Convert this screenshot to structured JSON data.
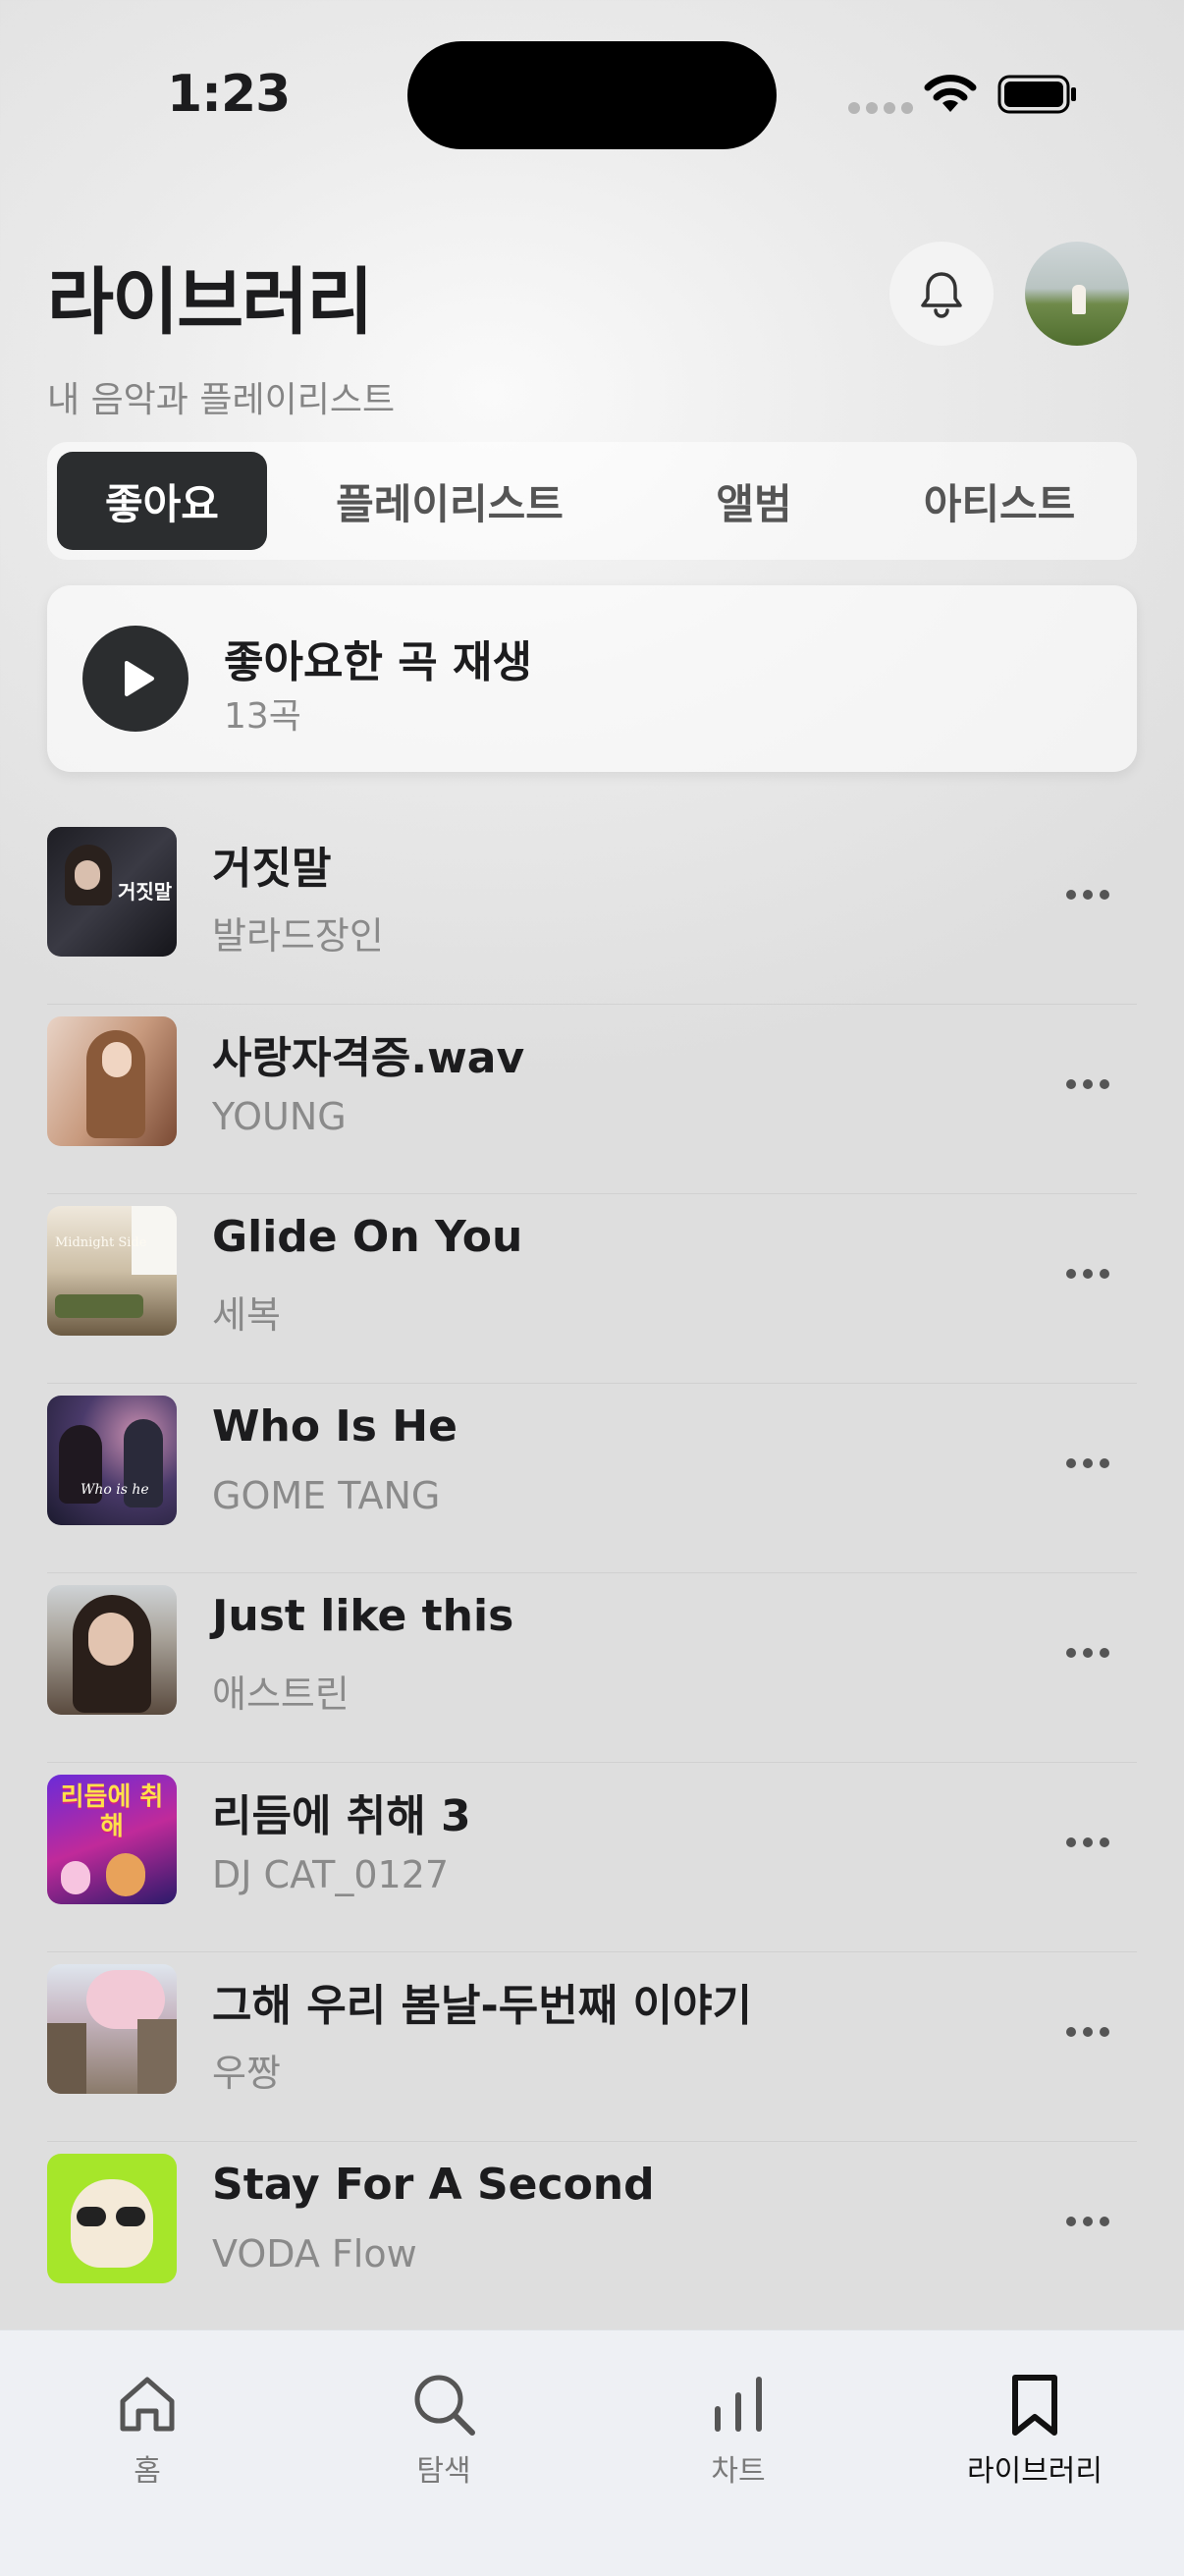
{
  "status_bar": {
    "time": "1:23"
  },
  "header": {
    "title": "라이브러리",
    "subtitle": "내 음악과 플레이리스트"
  },
  "tabs": [
    {
      "label": "좋아요",
      "active": true
    },
    {
      "label": "플레이리스트",
      "active": false
    },
    {
      "label": "앨범",
      "active": false
    },
    {
      "label": "아티스트",
      "active": false
    }
  ],
  "play_card": {
    "title": "좋아요한 곡 재생",
    "count": "13곡"
  },
  "songs": [
    {
      "title": "거짓말",
      "artist": "발라드장인"
    },
    {
      "title": "사랑자격증.wav",
      "artist": "YOUNG"
    },
    {
      "title": "Glide On You",
      "artist": "세복"
    },
    {
      "title": "Who Is He",
      "artist": "GOME TANG"
    },
    {
      "title": "Just like this",
      "artist": "애스트린"
    },
    {
      "title": "리듬에 취해 3",
      "artist": "DJ CAT_0127"
    },
    {
      "title": "그해 우리 봄날-두번째 이야기",
      "artist": "우짱"
    },
    {
      "title": "Stay For A Second",
      "artist": "VODA Flow"
    }
  ],
  "artwork_text": {
    "s0": "거짓말",
    "s2": "Midnight Side",
    "s3": "Who is he",
    "s5": "리듬에 취해"
  },
  "bottom_nav": [
    {
      "label": "홈",
      "icon": "home-icon",
      "active": false
    },
    {
      "label": "탐색",
      "icon": "search-icon",
      "active": false
    },
    {
      "label": "차트",
      "icon": "chart-icon",
      "active": false
    },
    {
      "label": "라이브러리",
      "icon": "bookmark-icon",
      "active": true
    }
  ],
  "colors": {
    "accent_dark": "#2b2d2f",
    "secondary_text": "#8a8a8a"
  }
}
